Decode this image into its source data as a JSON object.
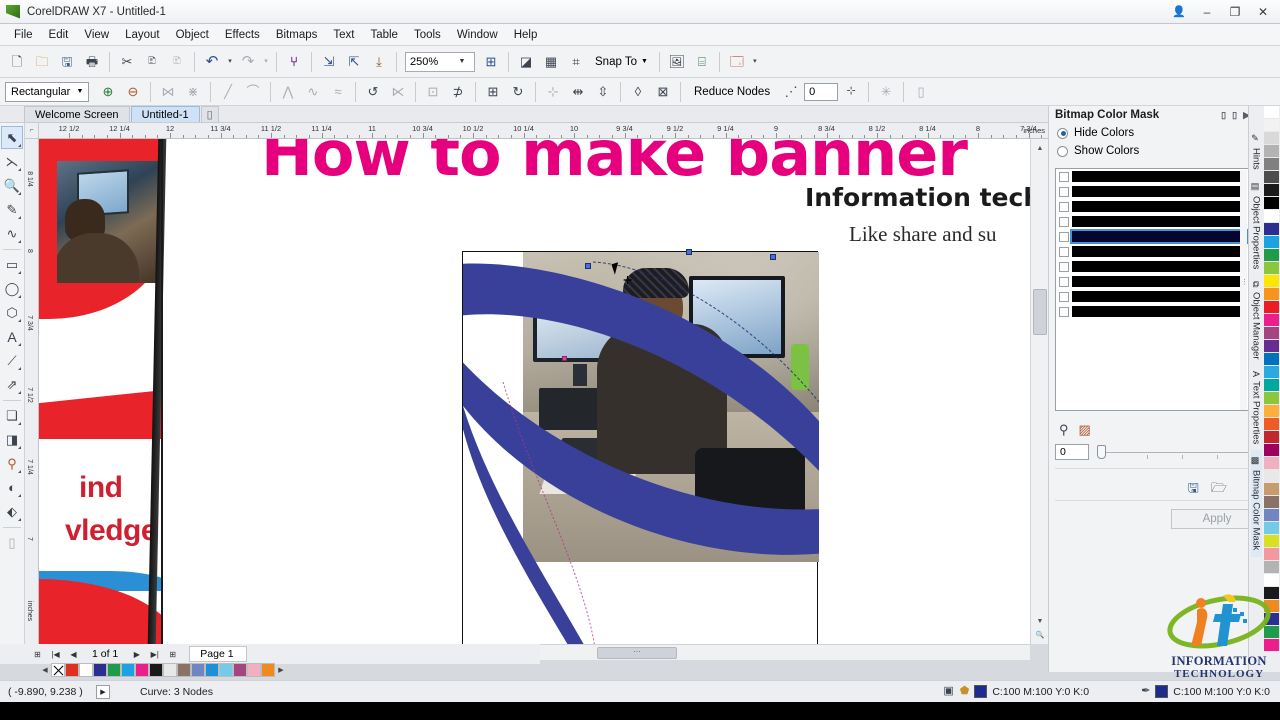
{
  "window": {
    "title": "CorelDRAW X7 - Untitled-1",
    "logo_icon": "coreldraw-logo-icon",
    "user_icon": "user-account-icon",
    "minimize": "–",
    "restore": "❐",
    "close": "✕"
  },
  "menu": {
    "items": [
      "File",
      "Edit",
      "View",
      "Layout",
      "Object",
      "Effects",
      "Bitmaps",
      "Text",
      "Table",
      "Tools",
      "Window",
      "Help"
    ]
  },
  "standard_toolbar": {
    "buttons": [
      {
        "name": "new-document-button",
        "glyph": "🗋"
      },
      {
        "name": "open-document-button",
        "glyph": "🗁"
      },
      {
        "name": "save-document-button",
        "glyph": "🖫"
      },
      {
        "name": "print-button",
        "glyph": "🖶"
      },
      {
        "name": "cut-button",
        "glyph": "✂"
      },
      {
        "name": "copy-button",
        "glyph": "⧉"
      },
      {
        "name": "paste-button",
        "glyph": "📋"
      },
      {
        "name": "undo-button",
        "glyph": "↶"
      },
      {
        "name": "undo-dropdown",
        "glyph": "▾"
      },
      {
        "name": "redo-button",
        "glyph": "↷"
      },
      {
        "name": "redo-dropdown",
        "glyph": "▾"
      },
      {
        "name": "import-button",
        "glyph": "⇲"
      },
      {
        "name": "export-button",
        "glyph": "⇱"
      },
      {
        "name": "publish-pdf-button",
        "glyph": "⤓"
      }
    ],
    "zoom_level": "250%",
    "zoom_dropdown_icon": "chevron-down-icon",
    "fullscreen_icon": "zoom-levels-icon",
    "snap_to_label": "Snap To",
    "snap_to_arrow": "▾",
    "options_icon": "options-icon",
    "launch_icon": "application-launcher-icon",
    "publish_icon": "publish-icon",
    "publish_arrow": "▾"
  },
  "property_bar": {
    "selection_mode": "Rectangular",
    "dropdown_icon": "chevron-down-icon",
    "reduce_nodes_label": "Reduce Nodes",
    "node_count": "0",
    "buttons": [
      {
        "name": "add-node-button",
        "glyph": "⊕"
      },
      {
        "name": "delete-node-button",
        "glyph": "⊖"
      },
      {
        "name": "join-nodes-button",
        "glyph": "⋈"
      },
      {
        "name": "break-curve-button",
        "glyph": "⋇"
      },
      {
        "name": "convert-to-line-button",
        "glyph": "╱"
      },
      {
        "name": "convert-to-curve-button",
        "glyph": "⌒"
      },
      {
        "name": "make-node-cusp-button",
        "glyph": "⋀"
      },
      {
        "name": "make-node-smooth-button",
        "glyph": "∿"
      },
      {
        "name": "make-node-symmetrical-button",
        "glyph": "≈"
      },
      {
        "name": "reverse-direction-button",
        "glyph": "↺"
      },
      {
        "name": "extend-curve-close-button",
        "glyph": "✕"
      },
      {
        "name": "extract-subpath-button",
        "glyph": "⊡"
      },
      {
        "name": "close-curve-button",
        "glyph": "⊃"
      },
      {
        "name": "stretch-nodes-button",
        "glyph": "⧉"
      },
      {
        "name": "rotate-nodes-button",
        "glyph": "↻"
      },
      {
        "name": "align-nodes-button",
        "glyph": "⊞"
      },
      {
        "name": "reflect-horizontal-button",
        "glyph": "⇔"
      },
      {
        "name": "reflect-vertical-button",
        "glyph": "⇕"
      },
      {
        "name": "elastic-mode-button",
        "glyph": "◊"
      },
      {
        "name": "select-all-nodes-button",
        "glyph": "⊠"
      }
    ],
    "curve-smoothness-icon": "smoothness-icon",
    "trailing_buttons": [
      {
        "name": "node-tracking-button",
        "glyph": "✳"
      },
      {
        "name": "object-properties-button",
        "glyph": "▯"
      }
    ]
  },
  "document_tabs": {
    "tabs": [
      "Welcome Screen",
      "Untitled-1"
    ],
    "active_index": 1,
    "add_tab_glyph": "▯"
  },
  "toolbox": {
    "tools": [
      {
        "name": "pick-tool",
        "glyph": "⬉",
        "active": true
      },
      {
        "name": "shape-tool",
        "glyph": "⊰"
      },
      {
        "name": "zoom-tool",
        "glyph": "🔍"
      },
      {
        "name": "freehand-tool",
        "glyph": "✎"
      },
      {
        "name": "artistic-media-tool",
        "glyph": "∿"
      },
      {
        "name": "rectangle-tool",
        "glyph": "▭"
      },
      {
        "name": "ellipse-tool",
        "glyph": "◯"
      },
      {
        "name": "polygon-tool",
        "glyph": "⬡"
      },
      {
        "name": "text-tool",
        "glyph": "A"
      },
      {
        "name": "parallel-dimension-tool",
        "glyph": "↗"
      },
      {
        "name": "straight-line-connector-tool",
        "glyph": "⇗"
      },
      {
        "name": "drop-shadow-tool",
        "glyph": "❏"
      },
      {
        "name": "transparency-tool",
        "glyph": "◨"
      },
      {
        "name": "color-eyedropper-tool",
        "glyph": "⚗"
      },
      {
        "name": "interactive-fill-tool",
        "glyph": "◐"
      },
      {
        "name": "smart-fill-tool",
        "glyph": "⬖"
      },
      {
        "name": "outline-tool",
        "glyph": "▤"
      }
    ]
  },
  "rulers": {
    "unit_label": "inches",
    "horizontal_labels": [
      "12 1/2",
      "12 1/4",
      "12",
      "11 3/4",
      "11 1/2",
      "11 1/4",
      "11",
      "10 3/4",
      "10 1/2",
      "10 1/4",
      "10",
      "9 3/4",
      "9 1/2",
      "9 1/4",
      "9",
      "8 3/4",
      "8 1/2",
      "8 1/4",
      "8",
      "7 3/4"
    ],
    "vertical_labels": [
      "8 1/4",
      "8",
      "7 3/4",
      "7 1/2",
      "7 1/4",
      "7",
      "inches"
    ],
    "corner_icon": "ruler-origin-icon"
  },
  "canvas": {
    "headline": "How to make banner",
    "subline1": "Information tech",
    "subline2": "Like share and su",
    "left_banner_text_1": "ind",
    "left_banner_text_2": "vledge",
    "headline_color": "#e6007e",
    "banner_text_color": "#cf2031",
    "swoosh_color": "#39409a"
  },
  "page_navigator": {
    "add_page_first_icon": "add-page-icon",
    "first_glyph": "|◀",
    "prev_glyph": "◀",
    "count_label": "1 of 1",
    "next_glyph": "▶",
    "last_glyph": "▶|",
    "add_page_last_icon": "add-page-icon",
    "page_tab": "Page 1"
  },
  "palette": {
    "nav_prev": "◀",
    "nav_next": "▶",
    "swatches": [
      "none",
      "#e03020",
      "#ffffff",
      "#2b2f8f",
      "#1e9c4a",
      "#1aa3e0",
      "#ec1e8c",
      "#1a1a1a",
      "#e8e8e8",
      "#8a7266",
      "#6f86c2",
      "#1f8fd6",
      "#73cbe8",
      "#a4457f",
      "#f0b0bf",
      "#f08a1e"
    ]
  },
  "docker": {
    "title": "Bitmap Color Mask",
    "pin_icon": "pin-icon",
    "minimize_icon": "minimize-docker-icon",
    "expand_icon": "expand-docker-icon",
    "hide_colors_label": "Hide Colors",
    "show_colors_label": "Show Colors",
    "selected_mode": "Hide Colors",
    "color_rows": 10,
    "selected_row_index": 4,
    "eyedropper_icon": "eyedropper-icon",
    "edit-color-icon": "edit-color-icon",
    "tolerance_value": "0",
    "save_icon": "save-mask-icon",
    "open_icon": "open-mask-icon",
    "apply_label": "Apply",
    "tabs": [
      "Hints",
      "Object Properties",
      "Object Manager",
      "Text Properties",
      "Bitmap Color Mask"
    ],
    "active_tab": "Bitmap Color Mask"
  },
  "statusbar": {
    "coordinates": "( -9.890, 9.238 )",
    "play_glyph": "▶",
    "object_info": "Curve: 3 Nodes",
    "snap_icon": "snap-indicator-icon",
    "fill_icon": "fill-color-icon",
    "fill_color_value": "C:100 M:100 Y:0 K:0",
    "outline_icon": "outline-color-icon",
    "outline_color_value": "C:100 M:100 Y:0 K:0",
    "swatch_color": "#1e2a8c"
  },
  "watermark": {
    "line1": "INFORMATION",
    "line2": "TECHNOLOGY"
  }
}
